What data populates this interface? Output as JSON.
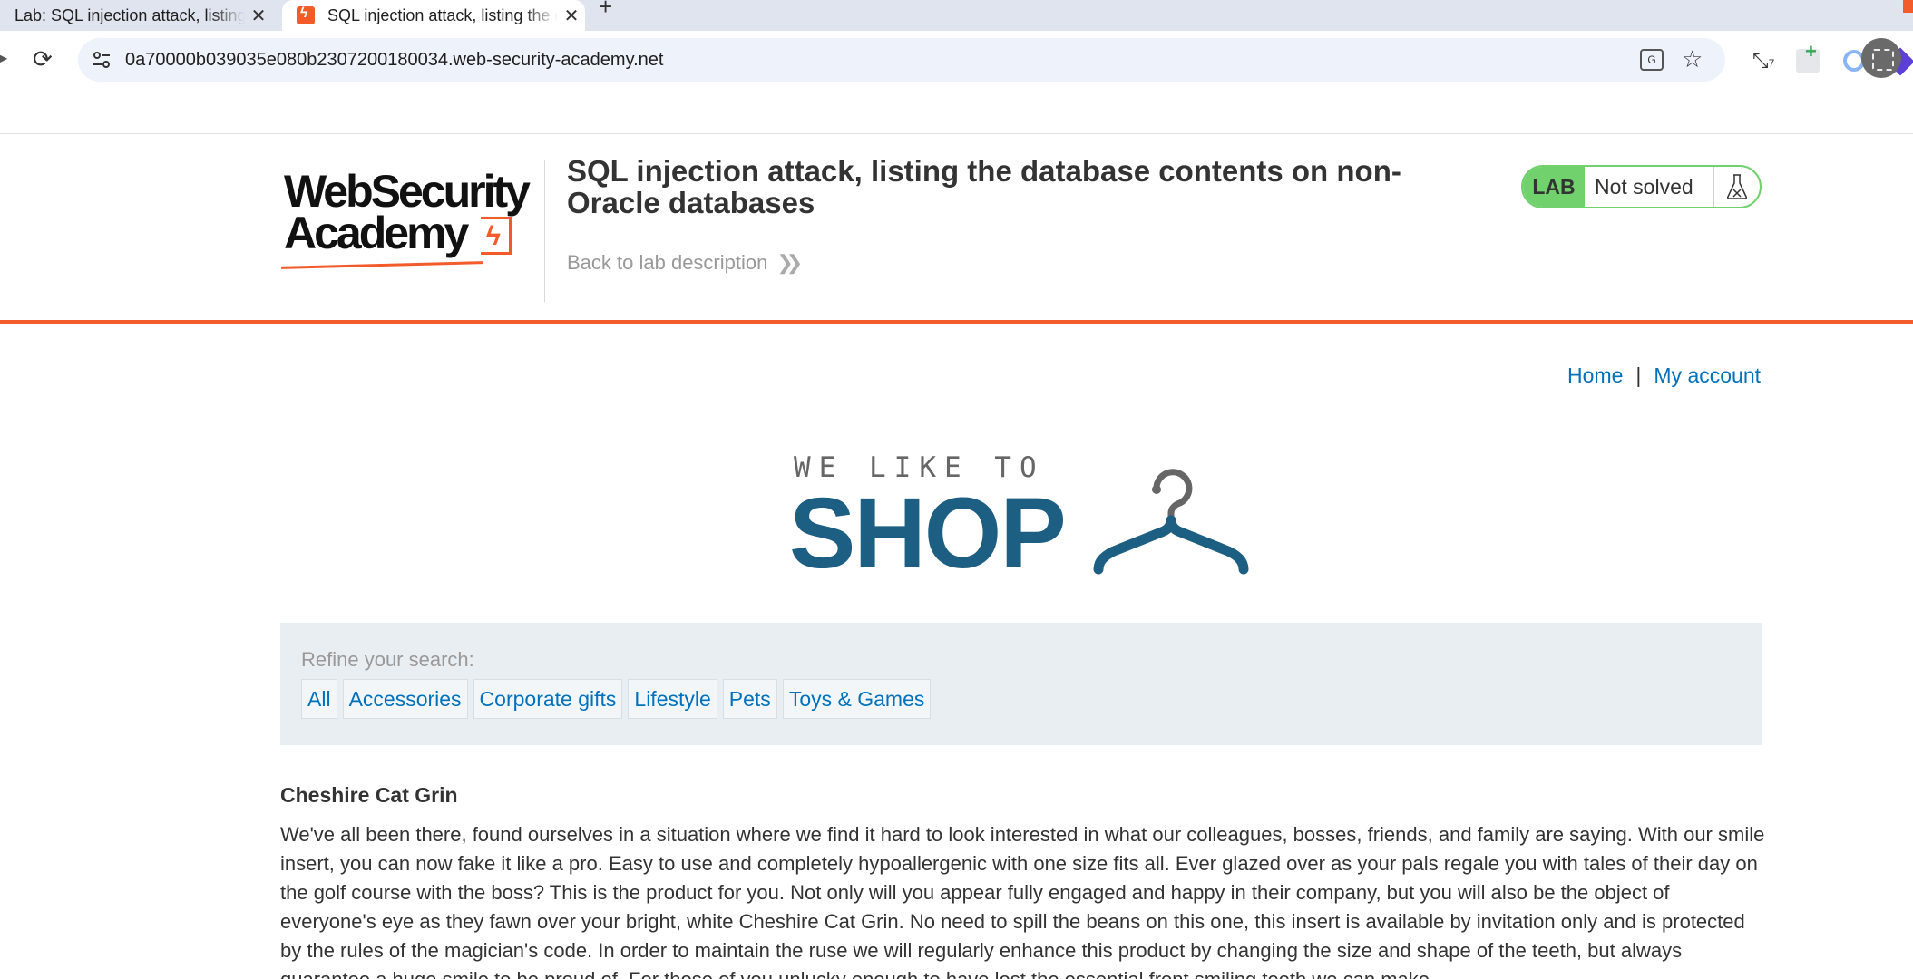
{
  "browser": {
    "tabs": [
      {
        "title": "Lab: SQL injection attack, listing the database contents",
        "active": false
      },
      {
        "title": "SQL injection attack, listing the database contents",
        "active": true
      }
    ],
    "new_tab": "+",
    "close_glyph": "✕",
    "url": "0a70000b039035e080b2307200180034.web-security-academy.net",
    "extension_badge": "7",
    "translate_glyph": "G"
  },
  "lab_header": {
    "logo_line1": "WebSecurity",
    "logo_line2": "Academy",
    "title": "SQL injection attack, listing the database contents on non-Oracle databases",
    "back_link": "Back to lab description",
    "badge": "LAB",
    "status": "Not solved",
    "colors": {
      "accent": "#f45b2a",
      "lab_green": "#70d16d"
    }
  },
  "nav": {
    "home": "Home",
    "separator": "|",
    "my_account": "My account"
  },
  "shop_logo": {
    "tagline": "WE LIKE TO",
    "word": "SHOP",
    "icon": "hanger-icon"
  },
  "filters": {
    "label": "Refine your search:",
    "items": [
      "All",
      "Accessories",
      "Corporate gifts",
      "Lifestyle",
      "Pets",
      "Toys & Games"
    ]
  },
  "product": {
    "title": "Cheshire Cat Grin",
    "description": "We've all been there, found ourselves in a situation where we find it hard to look interested in what our colleagues, bosses, friends, and family are saying. With our smile insert, you can now fake it like a pro. Easy to use and completely hypoallergenic with one size fits all. Ever glazed over as your pals regale you with tales of their day on the golf course with the boss? This is the product for you. Not only will you appear fully engaged and happy in their company, but you will also be the object of everyone's eye as they fawn over your bright, white Cheshire Cat Grin. No need to spill the beans on this one, this insert is available by invitation only and is protected by the rules of the magician's code. In order to maintain the ruse we will regularly enhance this product by changing the size and shape of the teeth, but always guarantee a huge smile to be proud of. For those of you unlucky enough to have lost the essential front smiling teeth we can make"
  }
}
